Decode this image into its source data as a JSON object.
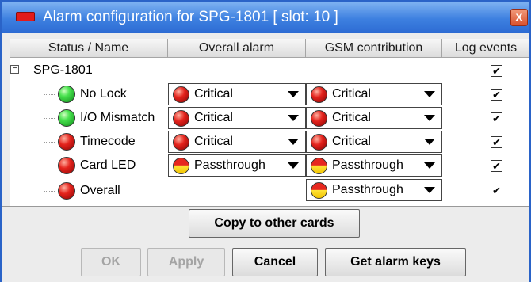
{
  "window": {
    "title": "Alarm configuration for SPG-1801 [ slot: 10 ]",
    "close_glyph": "x"
  },
  "columns": [
    "Status / Name",
    "Overall alarm",
    "GSM contribution",
    "Log events"
  ],
  "tree": {
    "expander_glyph": "−",
    "root_label": "SPG-1801"
  },
  "rows": [
    {
      "name": "No Lock",
      "status": "green",
      "overall": {
        "value": "Critical",
        "led": "red"
      },
      "gsm": {
        "value": "Critical",
        "led": "red"
      },
      "log": true
    },
    {
      "name": "I/O Mismatch",
      "status": "green",
      "overall": {
        "value": "Critical",
        "led": "red"
      },
      "gsm": {
        "value": "Critical",
        "led": "red"
      },
      "log": true
    },
    {
      "name": "Timecode",
      "status": "red",
      "overall": {
        "value": "Critical",
        "led": "red"
      },
      "gsm": {
        "value": "Critical",
        "led": "red"
      },
      "log": true
    },
    {
      "name": "Card LED",
      "status": "red",
      "overall": {
        "value": "Passthrough",
        "led": "yellow"
      },
      "gsm": {
        "value": "Passthrough",
        "led": "yellow"
      },
      "log": true
    },
    {
      "name": "Overall",
      "status": "red",
      "overall": null,
      "gsm": {
        "value": "Passthrough",
        "led": "yellow"
      },
      "log": true
    }
  ],
  "check_glyph": "✔",
  "buttons": {
    "copy": "Copy to other cards",
    "ok": "OK",
    "apply": "Apply",
    "cancel": "Cancel",
    "get_keys": "Get alarm keys"
  },
  "colors": {
    "titlebar": "#3d80e0",
    "led_red": "#e4231c",
    "led_green": "#49e24f",
    "led_yellow": "#ffe33a"
  }
}
